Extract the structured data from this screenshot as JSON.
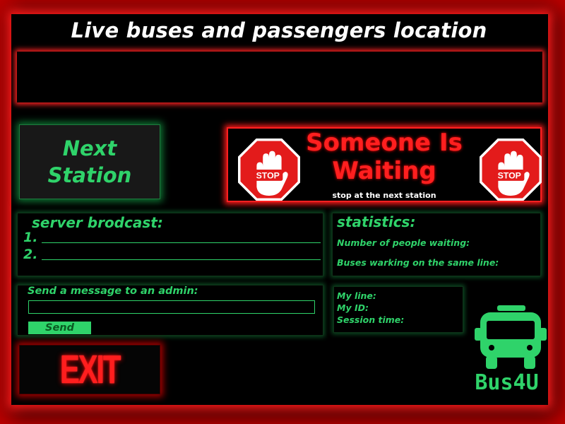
{
  "header": {
    "title": "Live buses and passengers location"
  },
  "next_station": {
    "line1": "Next",
    "line2": "Station"
  },
  "alert": {
    "title_line1": "Someone Is",
    "title_line2": "Waiting",
    "subtitle": "stop at the next station",
    "stop_sign_text": "STOP"
  },
  "broadcast": {
    "heading": "server brodcast:",
    "lines": [
      "1.",
      "2."
    ]
  },
  "statistics": {
    "heading": "statistics:",
    "people_waiting_label": "Number of people waiting:",
    "buses_same_line_label": "Buses warking on the same line:"
  },
  "message": {
    "heading": "Send a message to  an admin:",
    "input_value": "",
    "send_label": "Send"
  },
  "info": {
    "my_line_label": "My line:",
    "my_id_label": "My ID:",
    "session_time_label": "Session time:"
  },
  "exit": {
    "label": "EXIT"
  },
  "logo": {
    "text": "Bus4U"
  },
  "colors": {
    "accent_green": "#2fd36a",
    "alert_red": "#ff1f1f",
    "background": "#000000"
  }
}
